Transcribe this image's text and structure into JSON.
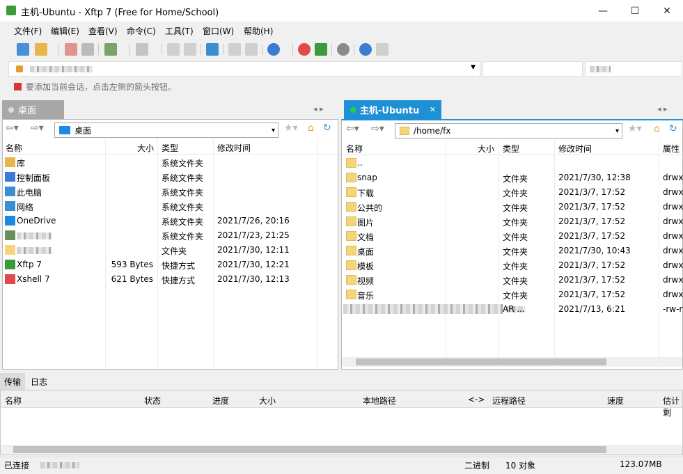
{
  "window": {
    "title": "主机-Ubuntu - Xftp 7 (Free for Home/School)",
    "min": "—",
    "max": "☐",
    "close": "✕"
  },
  "menu": [
    "文件(F)",
    "编辑(E)",
    "查看(V)",
    "命令(C)",
    "工具(T)",
    "窗口(W)",
    "帮助(H)"
  ],
  "hint": "要添加当前会话，点击左侧的箭头按钮。",
  "left": {
    "tab": "桌面",
    "path": "桌面",
    "columns": [
      "名称",
      "大小",
      "类型",
      "修改时间"
    ],
    "rows": [
      {
        "name": "库",
        "size": "",
        "type": "系统文件夹",
        "mtime": "",
        "icon": "library-icon"
      },
      {
        "name": "控制面板",
        "size": "",
        "type": "系统文件夹",
        "mtime": "",
        "icon": "control-panel-icon"
      },
      {
        "name": "此电脑",
        "size": "",
        "type": "系统文件夹",
        "mtime": "",
        "icon": "computer-icon"
      },
      {
        "name": "网络",
        "size": "",
        "type": "系统文件夹",
        "mtime": "",
        "icon": "network-icon"
      },
      {
        "name": "OneDrive",
        "size": "",
        "type": "系统文件夹",
        "mtime": "2021/7/26, 20:16",
        "icon": "onedrive-icon"
      },
      {
        "name": "",
        "size": "",
        "type": "系统文件夹",
        "mtime": "2021/7/23, 21:25",
        "icon": "user-icon"
      },
      {
        "name": "",
        "size": "",
        "type": "文件夹",
        "mtime": "2021/7/30, 12:11",
        "icon": "folder-icon"
      },
      {
        "name": "Xftp 7",
        "size": "593 Bytes",
        "type": "快捷方式",
        "mtime": "2021/7/30, 12:21",
        "icon": "xftp-icon"
      },
      {
        "name": "Xshell 7",
        "size": "621 Bytes",
        "type": "快捷方式",
        "mtime": "2021/7/30, 12:13",
        "icon": "xshell-icon"
      }
    ]
  },
  "right": {
    "tab": "主机-Ubuntu",
    "path": "/home/fx",
    "columns": [
      "名称",
      "大小",
      "类型",
      "修改时间",
      "属性"
    ],
    "rows": [
      {
        "name": "..",
        "size": "",
        "type": "",
        "mtime": "",
        "attr": ""
      },
      {
        "name": "snap",
        "size": "",
        "type": "文件夹",
        "mtime": "2021/7/30, 12:38",
        "attr": "drwx"
      },
      {
        "name": "下载",
        "size": "",
        "type": "文件夹",
        "mtime": "2021/3/7, 17:52",
        "attr": "drwx"
      },
      {
        "name": "公共的",
        "size": "",
        "type": "文件夹",
        "mtime": "2021/3/7, 17:52",
        "attr": "drwx"
      },
      {
        "name": "图片",
        "size": "",
        "type": "文件夹",
        "mtime": "2021/3/7, 17:52",
        "attr": "drwx"
      },
      {
        "name": "文档",
        "size": "",
        "type": "文件夹",
        "mtime": "2021/3/7, 17:52",
        "attr": "drwx"
      },
      {
        "name": "桌面",
        "size": "",
        "type": "文件夹",
        "mtime": "2021/7/30, 10:43",
        "attr": "drwx"
      },
      {
        "name": "模板",
        "size": "",
        "type": "文件夹",
        "mtime": "2021/3/7, 17:52",
        "attr": "drwx"
      },
      {
        "name": "视频",
        "size": "",
        "type": "文件夹",
        "mtime": "2021/3/7, 17:52",
        "attr": "drwx"
      },
      {
        "name": "音乐",
        "size": "",
        "type": "文件夹",
        "mtime": "2021/3/7, 17:52",
        "attr": "drwx"
      },
      {
        "name": "",
        "size": "",
        "type": "AR ...",
        "mtime": "2021/7/13, 6:21",
        "attr": "-rw-r"
      }
    ]
  },
  "transfer": {
    "tabs": [
      "传输",
      "日志"
    ],
    "columns": [
      "名称",
      "状态",
      "进度",
      "大小",
      "本地路径",
      "<->",
      "远程路径",
      "速度",
      "估计剩"
    ]
  },
  "status": {
    "connected": "已连接",
    "mode": "二进制",
    "objects": "10 对象",
    "size": "123.07MB"
  }
}
